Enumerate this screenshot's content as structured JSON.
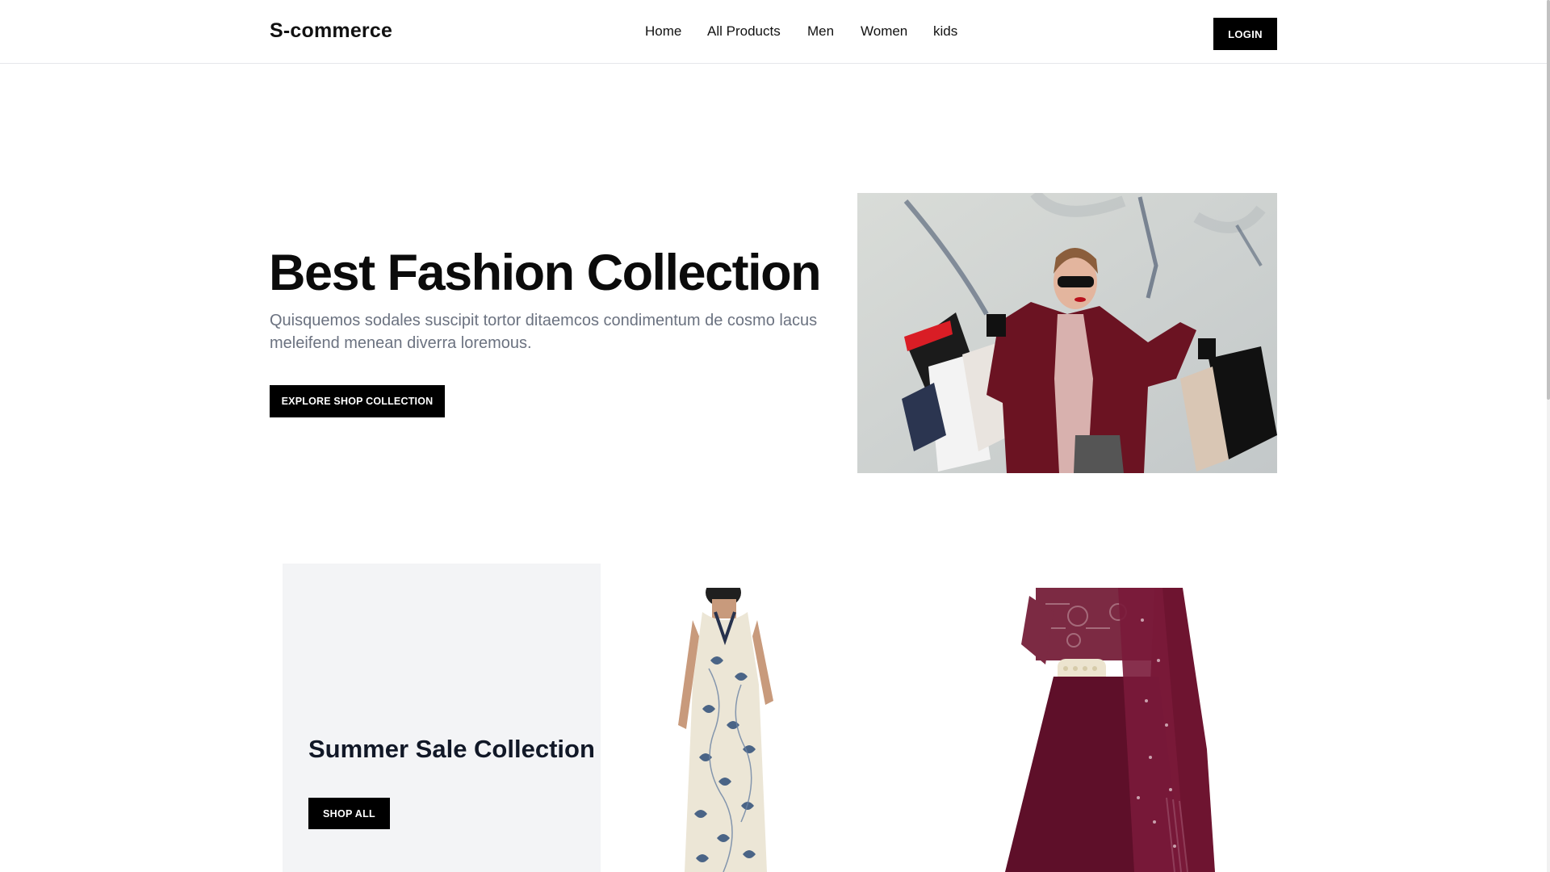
{
  "header": {
    "logo": "S-commerce",
    "nav": [
      "Home",
      "All Products",
      "Men",
      "Women",
      "kids"
    ],
    "login_label": "LOGIN"
  },
  "hero": {
    "title": "Best Fashion Collection",
    "subtitle": "Quisquemos sodales suscipit tortor ditaemcos condimentum de cosmo lacus meleifend menean diverra loremous.",
    "cta_label": "EXPLORE SHOP COLLECTION"
  },
  "promo": {
    "title": "Summer Sale Collection",
    "button_label": "SHOP ALL"
  },
  "colors": {
    "primary": "#000000",
    "text_muted": "#6b7280",
    "card_bg": "#f3f4f6",
    "border": "#e5e7eb"
  },
  "icons": {
    "hero_image": "woman-shopping-bags-photo",
    "product_1": "floral-kurta-photo",
    "product_2": "maroon-salwar-suit-photo"
  }
}
